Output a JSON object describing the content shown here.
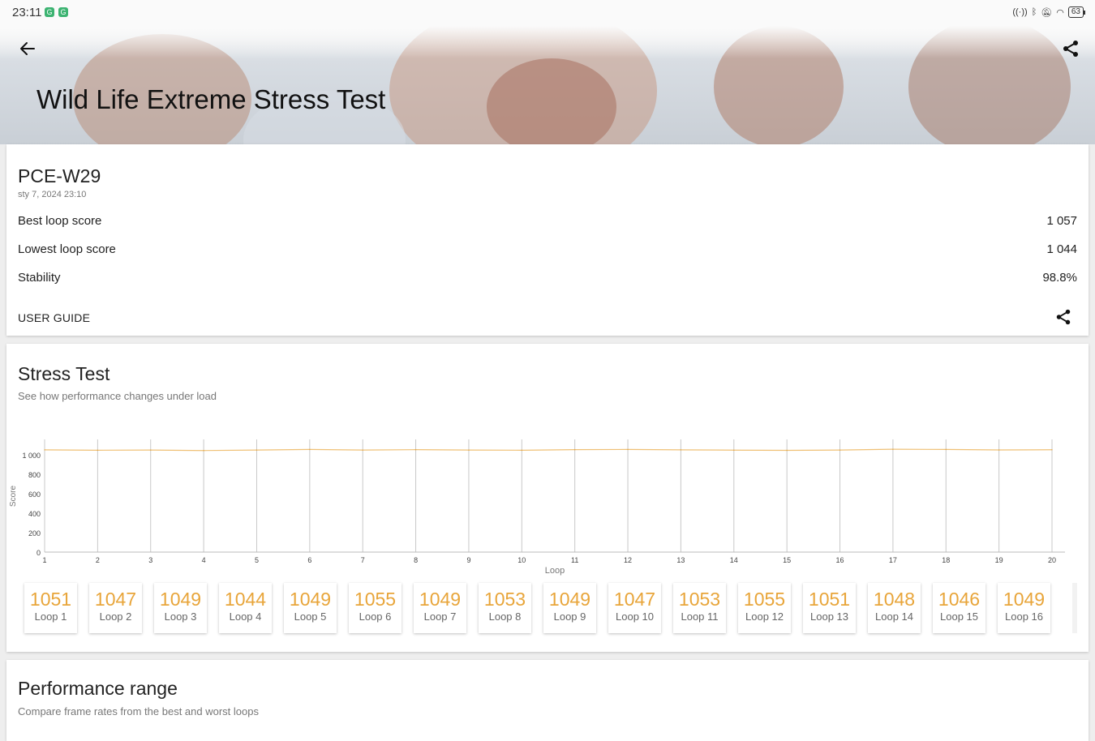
{
  "status_bar": {
    "time": "23:11",
    "battery": "63"
  },
  "header": {
    "title": "Wild Life Extreme Stress Test"
  },
  "summary": {
    "device": "PCE-W29",
    "date": "sty 7, 2024 23:10",
    "rows": [
      {
        "label": "Best loop score",
        "value": "1 057"
      },
      {
        "label": "Lowest loop score",
        "value": "1 044"
      },
      {
        "label": "Stability",
        "value": "98.8%"
      }
    ],
    "user_guide": "USER GUIDE"
  },
  "stress": {
    "title": "Stress Test",
    "subtitle": "See how performance changes under load"
  },
  "chart_data": {
    "type": "line",
    "xlabel": "Loop",
    "ylabel": "Score",
    "x": [
      1,
      2,
      3,
      4,
      5,
      6,
      7,
      8,
      9,
      10,
      11,
      12,
      13,
      14,
      15,
      16,
      17,
      18,
      19,
      20
    ],
    "y_ticks": [
      "0",
      "200",
      "400",
      "600",
      "800",
      "1 000"
    ],
    "ylim": [
      0,
      1000
    ],
    "series": [
      {
        "values": [
          1051,
          1047,
          1049,
          1044,
          1049,
          1055,
          1049,
          1053,
          1049,
          1047,
          1053,
          1055,
          1051,
          1048,
          1046,
          1049,
          1057,
          1055,
          1050,
          1052
        ]
      }
    ],
    "grid": "vertical",
    "color": "#e8a53a"
  },
  "loop_cards": [
    {
      "value": "1051",
      "label": "Loop 1"
    },
    {
      "value": "1047",
      "label": "Loop 2"
    },
    {
      "value": "1049",
      "label": "Loop 3"
    },
    {
      "value": "1044",
      "label": "Loop 4"
    },
    {
      "value": "1049",
      "label": "Loop 5"
    },
    {
      "value": "1055",
      "label": "Loop 6"
    },
    {
      "value": "1049",
      "label": "Loop 7"
    },
    {
      "value": "1053",
      "label": "Loop 8"
    },
    {
      "value": "1049",
      "label": "Loop 9"
    },
    {
      "value": "1047",
      "label": "Loop 10"
    },
    {
      "value": "1053",
      "label": "Loop 11"
    },
    {
      "value": "1055",
      "label": "Loop 12"
    },
    {
      "value": "1051",
      "label": "Loop 13"
    },
    {
      "value": "1048",
      "label": "Loop 14"
    },
    {
      "value": "1046",
      "label": "Loop 15"
    },
    {
      "value": "1049",
      "label": "Loop 16"
    }
  ],
  "performance_range": {
    "title": "Performance range",
    "subtitle": "Compare frame rates from the best and worst loops"
  },
  "icons": [
    "back-arrow-icon",
    "share-icon"
  ],
  "colors": {
    "accent": "#e8a53a"
  }
}
